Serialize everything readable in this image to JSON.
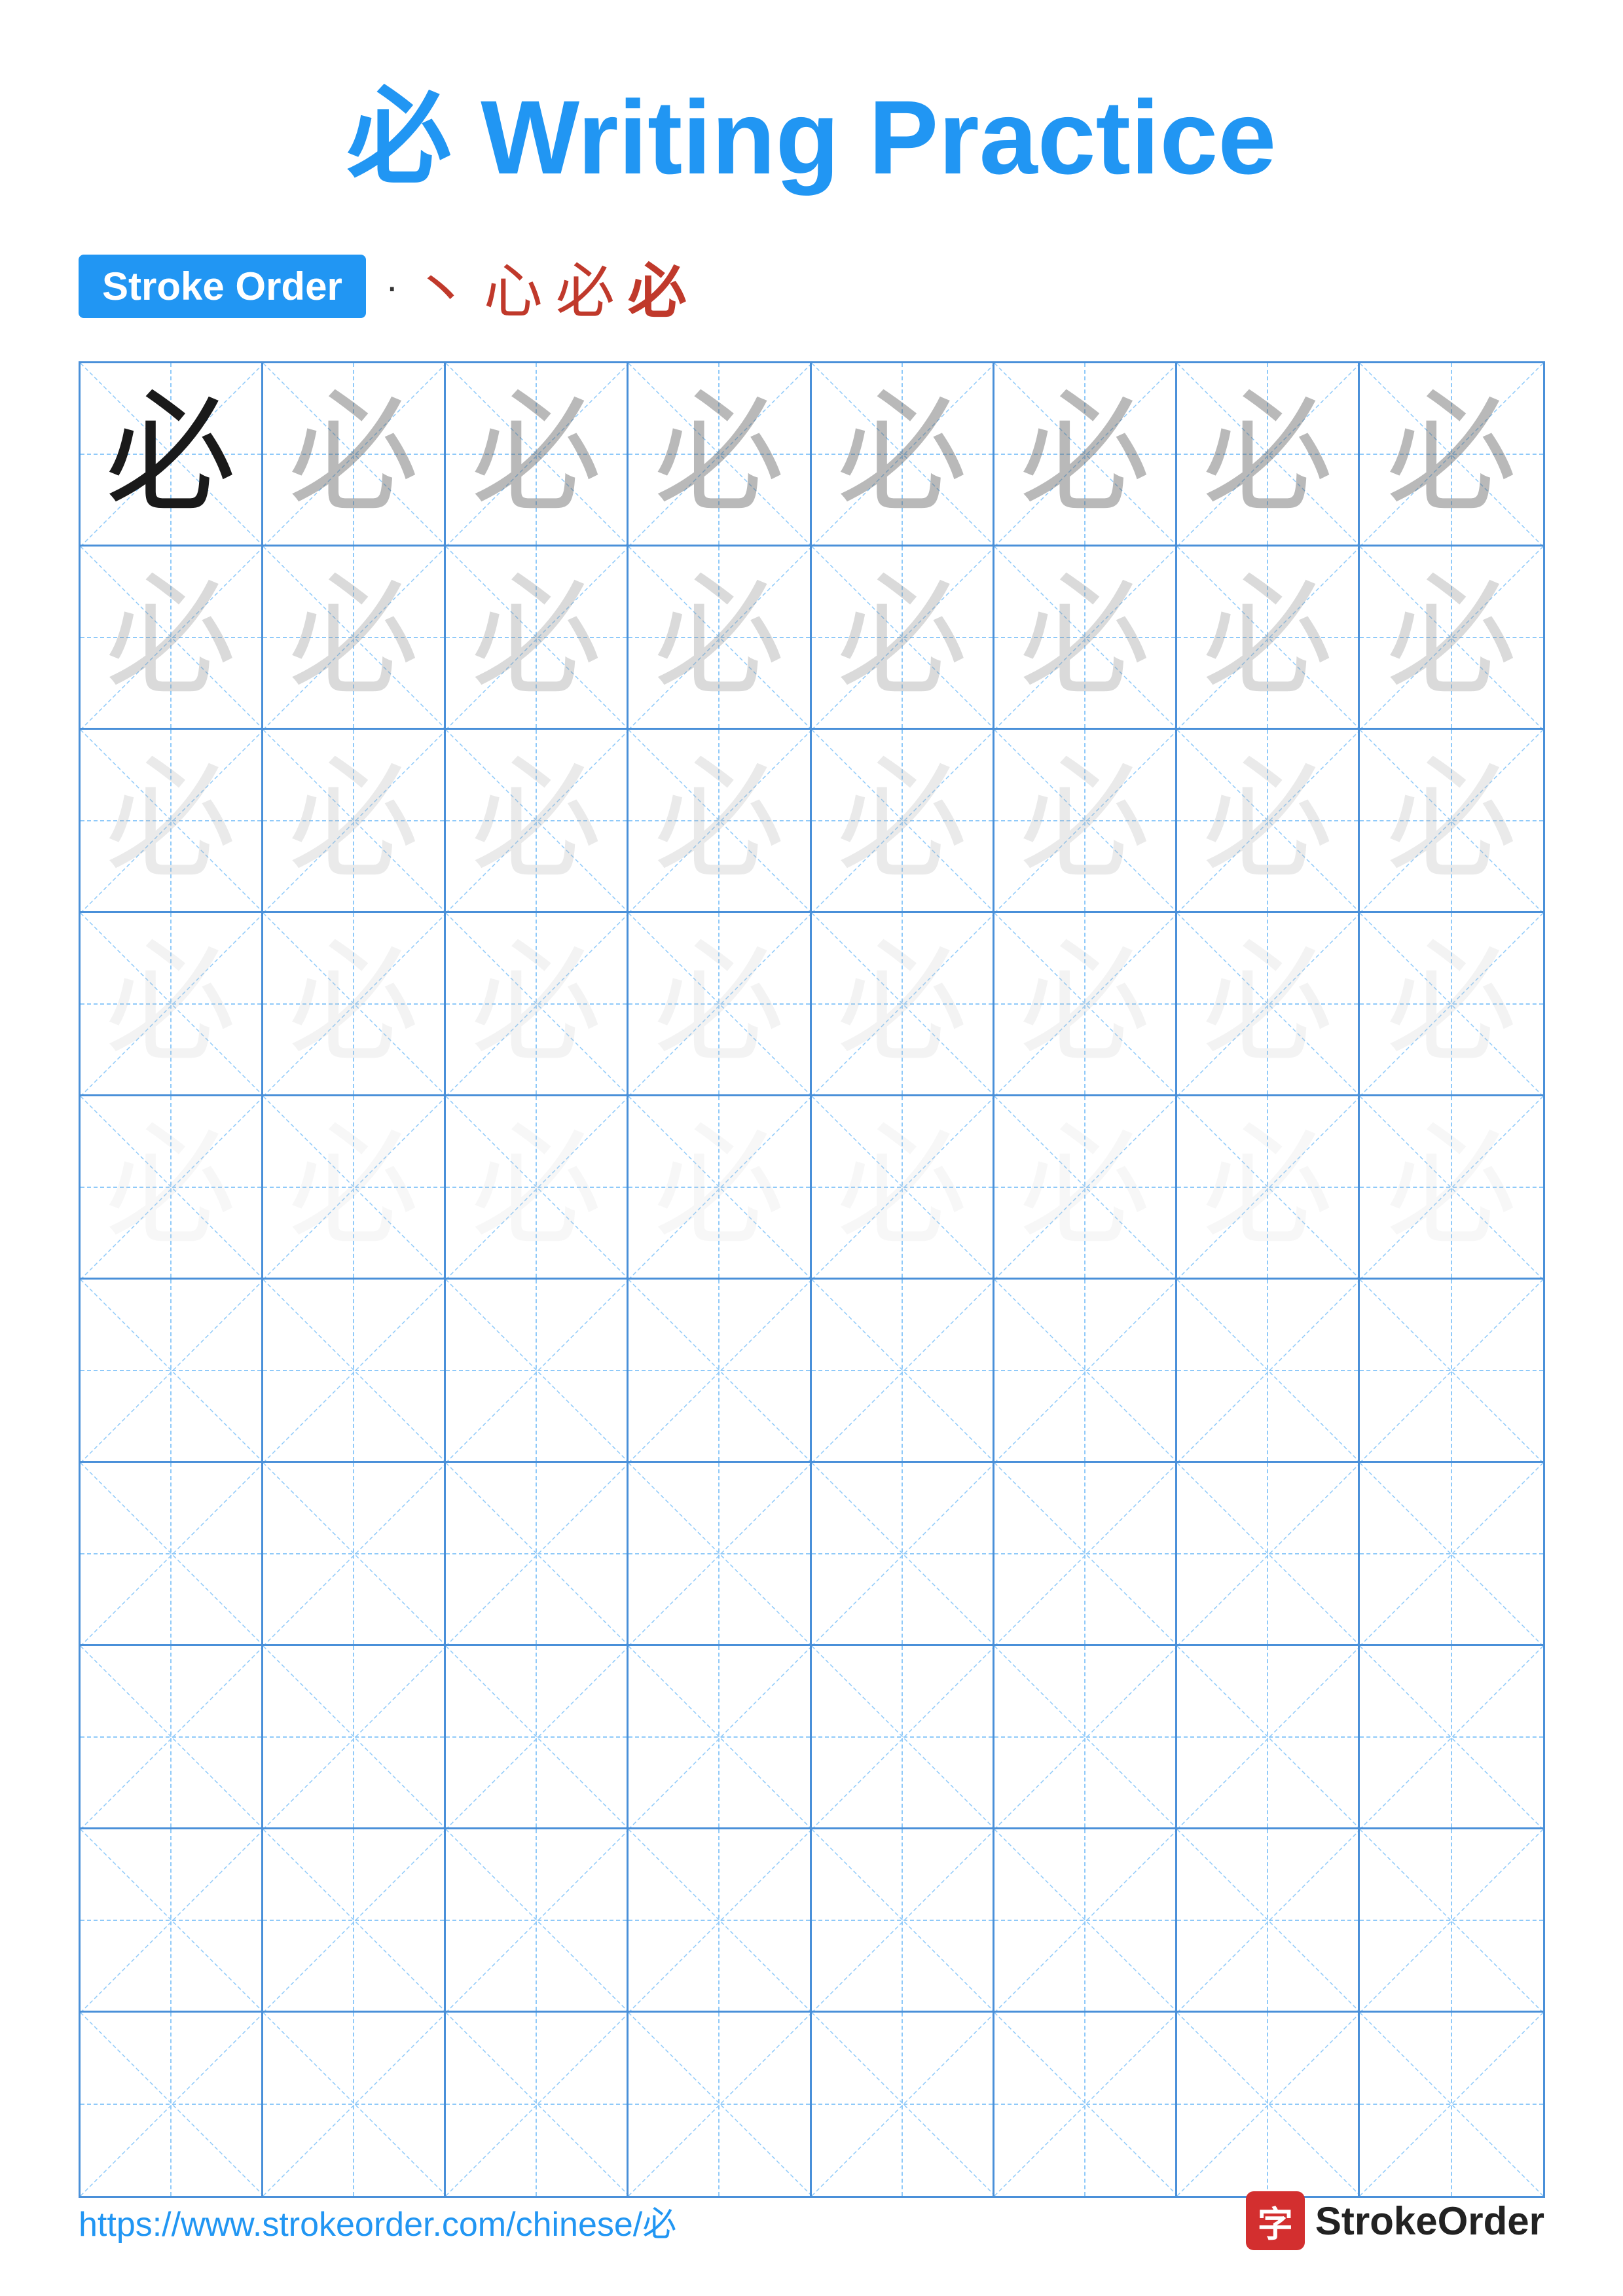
{
  "title": {
    "char": "必",
    "text": " Writing Practice"
  },
  "stroke_order": {
    "badge_label": "Stroke Order",
    "dot": "·",
    "sequence": [
      "丶",
      "心",
      "必",
      "必"
    ]
  },
  "grid": {
    "cols": 8,
    "rows": 10,
    "character": "必",
    "practice_rows": 5,
    "empty_rows": 5
  },
  "footer": {
    "url": "https://www.strokeorder.com/chinese/必",
    "logo_char": "字",
    "logo_text": "StrokeOrder"
  }
}
